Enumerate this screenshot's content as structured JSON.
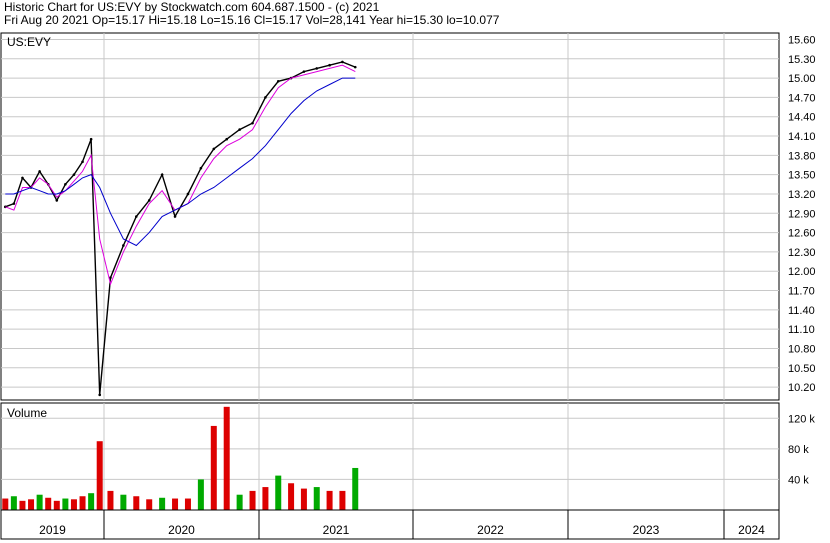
{
  "header": {
    "line1": "Historic Chart for US:EVY by Stockwatch.com 604.687.1500 - (c) 2021",
    "line2": "Fri Aug 20 2021  Op=15.17  Hi=15.18  Lo=15.16  Cl=15.17  Vol=28,141  Year hi=15.30  lo=10.077"
  },
  "chart_data": [
    {
      "type": "line",
      "panel": "price",
      "label": "US:EVY",
      "ylim": [
        10.0,
        15.7
      ],
      "yticks": [
        "15.60",
        "15.30",
        "15.00",
        "14.70",
        "14.40",
        "14.10",
        "13.80",
        "13.50",
        "13.20",
        "12.90",
        "12.60",
        "12.30",
        "12.00",
        "11.70",
        "11.40",
        "11.10",
        "10.80",
        "10.50",
        "10.20"
      ],
      "grid": true,
      "series": [
        {
          "name": "",
          "style": "price-bars",
          "color": "#000000",
          "x": [
            "2019-01",
            "2019-02",
            "2019-03",
            "2019-04",
            "2019-05",
            "2019-06",
            "2019-07",
            "2019-08",
            "2019-09",
            "2019-10",
            "2019-11",
            "2019-12",
            "2020-01",
            "2020-02",
            "2020-03",
            "2020-04",
            "2020-05",
            "2020-06",
            "2020-07",
            "2020-08",
            "2020-09",
            "2020-10",
            "2020-11",
            "2020-12",
            "2021-01",
            "2021-02",
            "2021-03",
            "2021-04",
            "2021-05",
            "2021-06",
            "2021-07",
            "2021-08"
          ],
          "values": [
            13.0,
            13.05,
            13.45,
            13.3,
            13.55,
            13.35,
            13.1,
            13.35,
            13.5,
            13.7,
            14.05,
            10.08,
            11.9,
            12.4,
            12.85,
            13.1,
            13.5,
            12.85,
            13.2,
            13.6,
            13.9,
            14.05,
            14.2,
            14.3,
            14.7,
            14.95,
            15.0,
            15.1,
            15.15,
            15.2,
            15.25,
            15.17
          ]
        },
        {
          "name": "",
          "style": "moving-average",
          "color": "#dd00dd",
          "x": [
            "2019-01",
            "2019-02",
            "2019-03",
            "2019-04",
            "2019-05",
            "2019-06",
            "2019-07",
            "2019-08",
            "2019-09",
            "2019-10",
            "2019-11",
            "2019-12",
            "2020-01",
            "2020-02",
            "2020-03",
            "2020-04",
            "2020-05",
            "2020-06",
            "2020-07",
            "2020-08",
            "2020-09",
            "2020-10",
            "2020-11",
            "2020-12",
            "2021-01",
            "2021-02",
            "2021-03",
            "2021-04",
            "2021-05",
            "2021-06",
            "2021-07",
            "2021-08"
          ],
          "values": [
            13.0,
            12.95,
            13.3,
            13.3,
            13.45,
            13.35,
            13.15,
            13.25,
            13.4,
            13.55,
            13.8,
            12.5,
            11.8,
            12.3,
            12.7,
            13.05,
            13.25,
            12.95,
            13.05,
            13.45,
            13.75,
            13.95,
            14.05,
            14.2,
            14.55,
            14.85,
            15.0,
            15.05,
            15.1,
            15.15,
            15.2,
            15.1
          ]
        },
        {
          "name": "",
          "style": "moving-average",
          "color": "#0000cc",
          "x": [
            "2019-01",
            "2019-02",
            "2019-03",
            "2019-04",
            "2019-05",
            "2019-06",
            "2019-07",
            "2019-08",
            "2019-09",
            "2019-10",
            "2019-11",
            "2019-12",
            "2020-01",
            "2020-02",
            "2020-03",
            "2020-04",
            "2020-05",
            "2020-06",
            "2020-07",
            "2020-08",
            "2020-09",
            "2020-10",
            "2020-11",
            "2020-12",
            "2021-01",
            "2021-02",
            "2021-03",
            "2021-04",
            "2021-05",
            "2021-06",
            "2021-07",
            "2021-08"
          ],
          "values": [
            13.2,
            13.2,
            13.25,
            13.3,
            13.25,
            13.2,
            13.2,
            13.25,
            13.35,
            13.45,
            13.5,
            13.3,
            12.9,
            12.5,
            12.4,
            12.6,
            12.85,
            12.95,
            13.05,
            13.2,
            13.3,
            13.45,
            13.6,
            13.75,
            13.95,
            14.2,
            14.45,
            14.65,
            14.8,
            14.9,
            15.0,
            15.0
          ]
        }
      ]
    },
    {
      "type": "bar",
      "panel": "volume",
      "label": "Volume",
      "ylim": [
        0,
        140
      ],
      "yticks": [
        "120 k",
        "80 k",
        "40 k"
      ],
      "grid": true,
      "categories": [
        "2019-01",
        "2019-02",
        "2019-03",
        "2019-04",
        "2019-05",
        "2019-06",
        "2019-07",
        "2019-08",
        "2019-09",
        "2019-10",
        "2019-11",
        "2019-12",
        "2020-01",
        "2020-02",
        "2020-03",
        "2020-04",
        "2020-05",
        "2020-06",
        "2020-07",
        "2020-08",
        "2020-09",
        "2020-10",
        "2020-11",
        "2020-12",
        "2021-01",
        "2021-02",
        "2021-03",
        "2021-04",
        "2021-05",
        "2021-06",
        "2021-07",
        "2021-08"
      ],
      "values": [
        15,
        18,
        12,
        14,
        20,
        16,
        12,
        15,
        14,
        18,
        22,
        90,
        25,
        20,
        18,
        14,
        16,
        15,
        15,
        40,
        110,
        135,
        20,
        25,
        30,
        45,
        35,
        28,
        30,
        25,
        25,
        55
      ]
    }
  ],
  "x_axis": {
    "years": [
      "2019",
      "2020",
      "2021",
      "2022",
      "2023",
      "2024"
    ]
  }
}
